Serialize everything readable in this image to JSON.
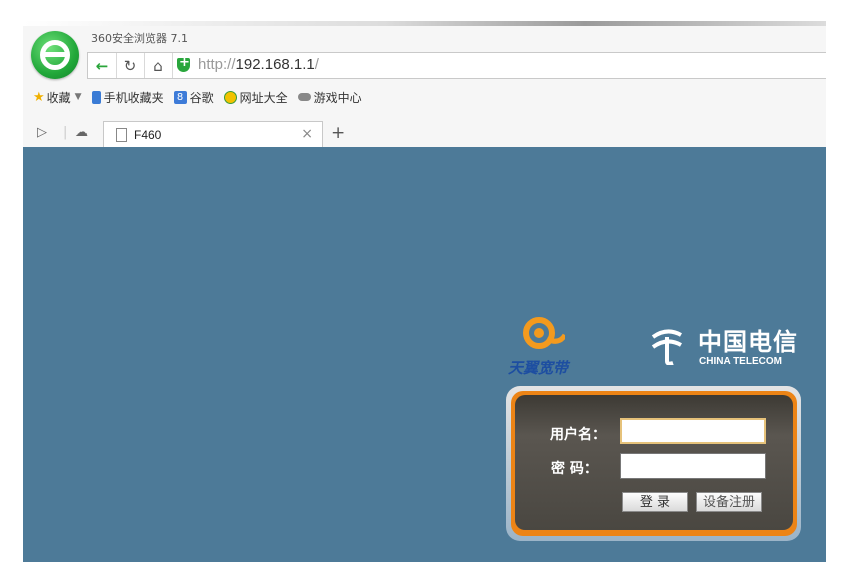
{
  "browser": {
    "title": "360安全浏览器 7.1",
    "url_protocol": "http://",
    "url_host": "192.168.1.1",
    "url_path": "/",
    "bookmarks": [
      {
        "label": "收藏",
        "icon": "star-icon"
      },
      {
        "label": "手机收藏夹",
        "icon": "phone-icon"
      },
      {
        "label": "谷歌",
        "icon": "google-icon"
      },
      {
        "label": "网址大全",
        "icon": "globe-icon"
      },
      {
        "label": "游戏中心",
        "icon": "gamepad-icon"
      }
    ],
    "tab": {
      "title": "F460"
    }
  },
  "brand": {
    "tianyi": "天翼宽带",
    "telecom_cn": "中国电信",
    "telecom_en": "CHINA TELECOM"
  },
  "login": {
    "username_label": "用户名：",
    "password_label": "密 码：",
    "username_value": "",
    "password_value": "",
    "login_button": "登 录",
    "register_button": "设备注册"
  },
  "colors": {
    "page_bg": "#4d7a98",
    "panel_orange": "#ec8416",
    "panel_dark": "#4a4741",
    "brand_green": "#29a63c"
  }
}
